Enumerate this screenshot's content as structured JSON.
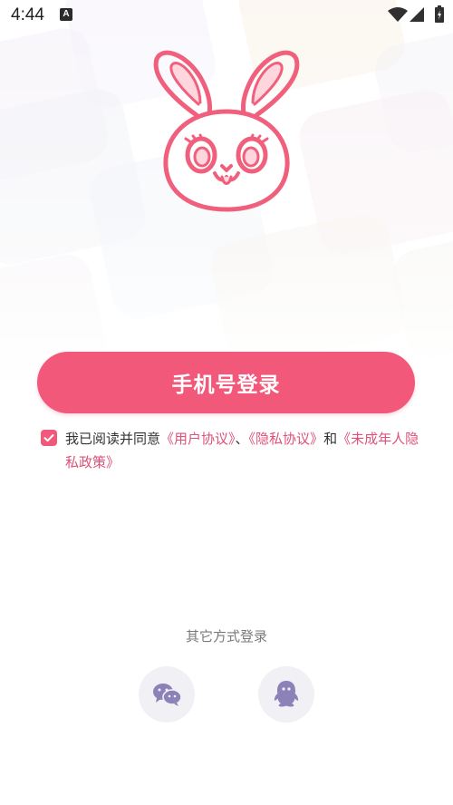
{
  "status_bar": {
    "time": "4:44",
    "badge": "A"
  },
  "colors": {
    "accent": "#f2587a",
    "link": "#e05078",
    "icon_purple": "#8c82b8"
  },
  "login": {
    "phone_button_label": "手机号登录"
  },
  "agreement": {
    "checked": true,
    "text_1": "我已阅读并同意",
    "user_agreement": "《用户协议》",
    "sep_1": "、",
    "privacy_agreement": "《隐私协议》",
    "sep_2": "和",
    "minor_privacy_policy": "《未成年人隐私政策》"
  },
  "other_login": {
    "title": "其它方式登录",
    "methods": [
      {
        "icon": "wechat-icon"
      },
      {
        "icon": "qq-icon"
      }
    ]
  }
}
